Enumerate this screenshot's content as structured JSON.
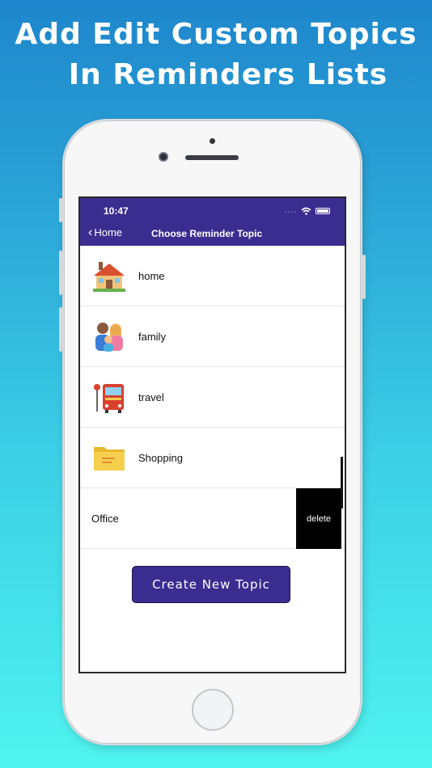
{
  "headline": {
    "line1": "Add Edit Custom Topics",
    "line2": "In Reminders Lists"
  },
  "status_bar": {
    "time": "10:47",
    "signal_dots": "....",
    "wifi": "wifi-icon",
    "battery": "battery-icon"
  },
  "navbar": {
    "back_label": "Home",
    "title": "Choose Reminder Topic",
    "color": "#3b2d8f"
  },
  "topics": [
    {
      "label": "home",
      "icon": "house-icon"
    },
    {
      "label": "family",
      "icon": "family-icon"
    },
    {
      "label": "travel",
      "icon": "bus-stop-icon"
    },
    {
      "label": "Shopping",
      "icon": "folder-icon"
    },
    {
      "label": "Office",
      "icon": "",
      "swiped": true
    }
  ],
  "row_actions": {
    "delete_label": "delete"
  },
  "create_button": {
    "label": "Create New Topic"
  }
}
